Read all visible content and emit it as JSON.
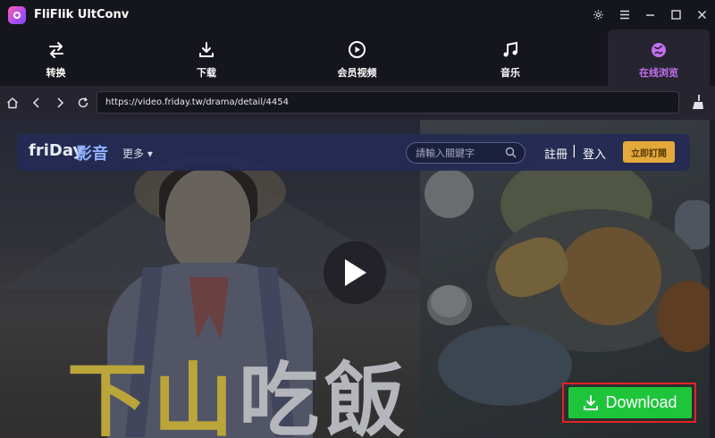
{
  "app": {
    "title": "FliFlik UltConv"
  },
  "tabs": [
    {
      "label": "转换",
      "icon": "convert-icon"
    },
    {
      "label": "下载",
      "icon": "download-icon"
    },
    {
      "label": "会员视频",
      "icon": "play-circle-icon"
    },
    {
      "label": "音乐",
      "icon": "music-icon"
    },
    {
      "label": "在线浏览",
      "icon": "globe-icon",
      "active": true
    }
  ],
  "browser": {
    "url": "https://video.friday.tw/drama/detail/4454"
  },
  "site": {
    "logo": "friDay",
    "logo_sub": "影音",
    "more": "更多",
    "search_placeholder": "請輸入關鍵字",
    "register": "註冊",
    "separator": "|",
    "login": "登入",
    "subscribe": "立即訂閱"
  },
  "download": {
    "label": "Download"
  },
  "colors": {
    "accent_active_tab": "#c46ff2",
    "download_green": "#1ec53a",
    "highlight_red": "#e02424",
    "subscribe_gold": "#e3a93a"
  }
}
